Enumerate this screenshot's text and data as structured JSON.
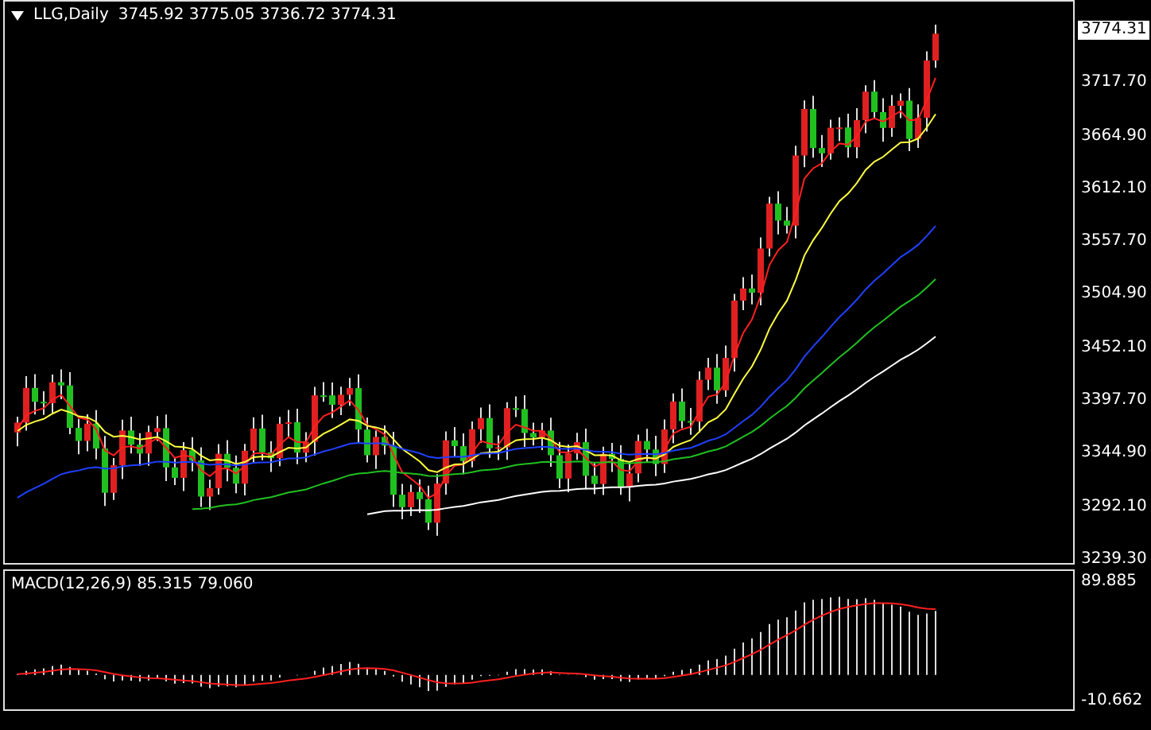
{
  "header": {
    "symbol": "LLG,Daily",
    "ohlc": "3745.92 3775.05 3736.72 3774.31"
  },
  "price_axis": {
    "current_price": "3774.31",
    "ticks": [
      "3717.70",
      "3664.90",
      "3612.10",
      "3557.70",
      "3504.90",
      "3452.10",
      "3397.70",
      "3344.90",
      "3292.10",
      "3239.30"
    ]
  },
  "macd": {
    "label": "MACD(12,26,9) 85.315 79.060",
    "axis_ticks": [
      "89.885",
      "-10.662"
    ]
  }
}
